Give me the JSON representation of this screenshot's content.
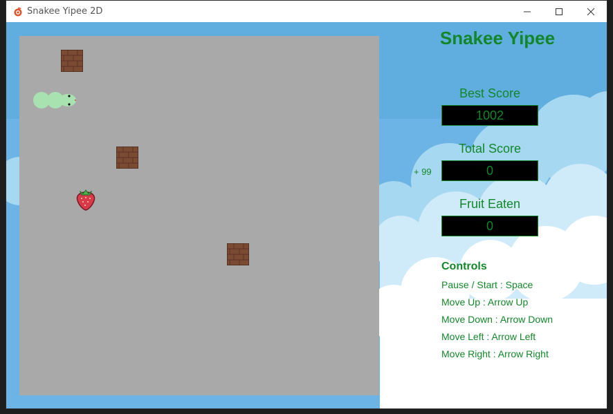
{
  "window": {
    "title": "Snakee Yipee 2D",
    "controls": [
      "minimize-icon",
      "maximize-icon",
      "close-icon"
    ]
  },
  "panel": {
    "title": "Snakee Yipee",
    "best_score_label": "Best Score",
    "best_score": "1002",
    "total_score_label": "Total Score",
    "total_score": "0",
    "bonus": "+ 99",
    "fruit_eaten_label": "Fruit Eaten",
    "fruit_eaten": "0",
    "controls_title": "Controls",
    "controls": [
      "Pause / Start : Space",
      "Move Up : Arrow Up",
      "Move Down : Arrow Down",
      "Move Left : Arrow Left",
      "Move Right : Arrow Right"
    ]
  },
  "board": {
    "background": "#a9a9a9",
    "items": [
      "brick-wall-icon",
      "brick-wall-icon",
      "brick-wall-icon",
      "strawberry-icon",
      "snake"
    ]
  },
  "colors": {
    "accent": "#12872a",
    "sky": "#6cb4e6",
    "snake": "#a8e2b0"
  }
}
